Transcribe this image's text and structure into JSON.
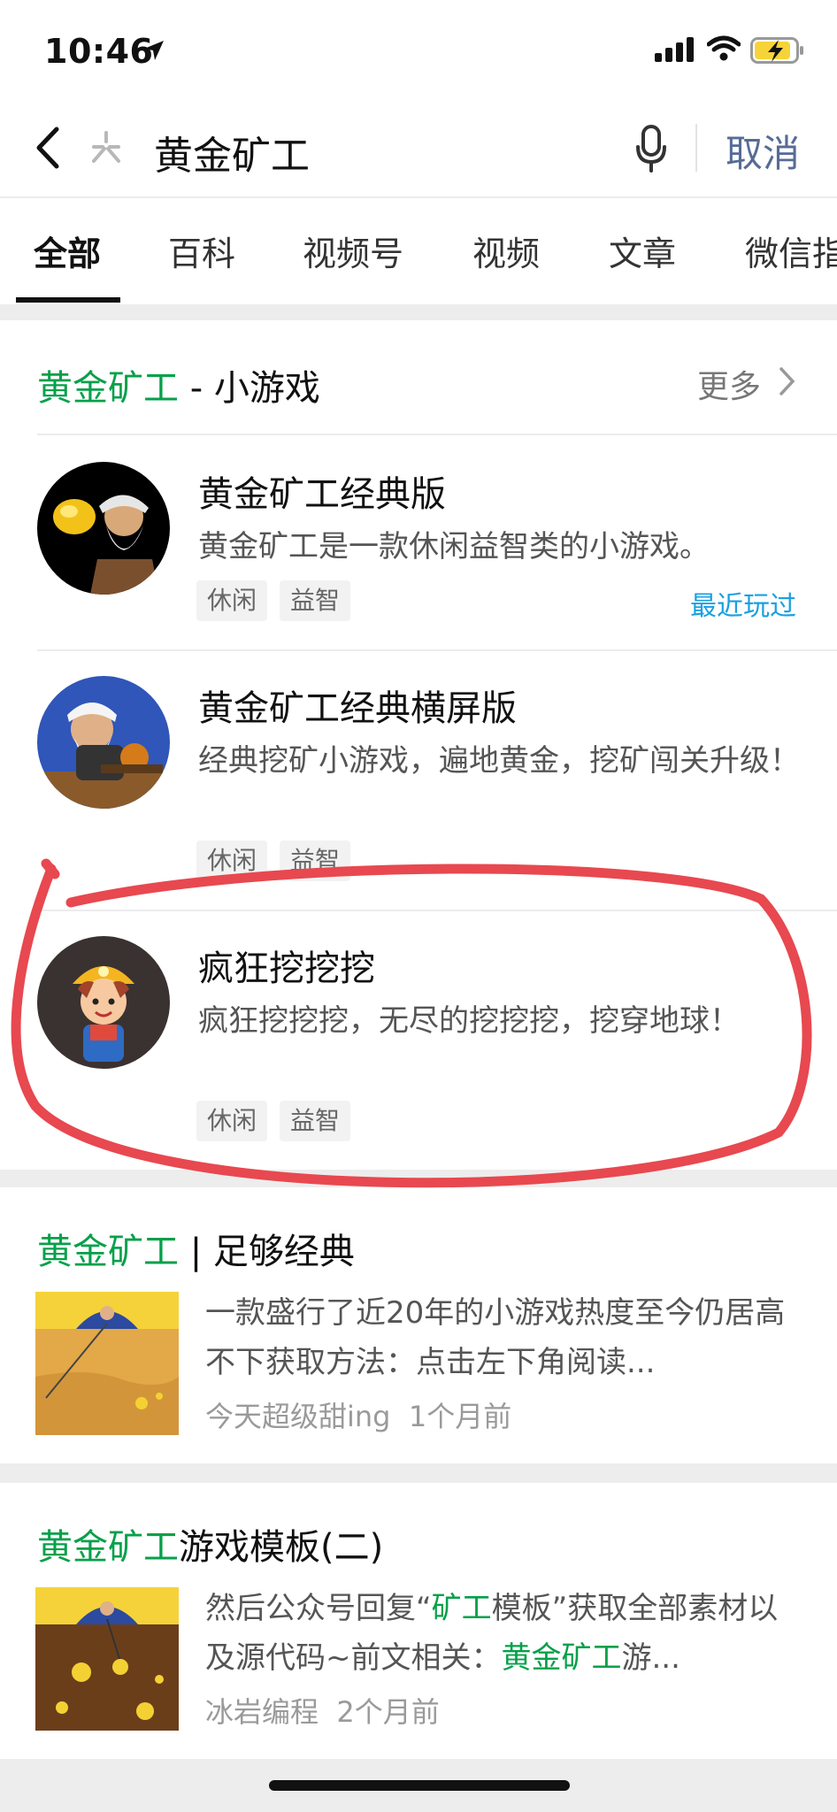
{
  "status": {
    "time": "10:46"
  },
  "search": {
    "query": "黄金矿工",
    "cancel": "取消"
  },
  "tabs": [
    "全部",
    "百科",
    "视频号",
    "视频",
    "文章",
    "微信指"
  ],
  "minigames": {
    "title_highlight": "黄金矿工",
    "title_rest": " - 小游戏",
    "more": "更多",
    "items": [
      {
        "name": "黄金矿工经典版",
        "desc": "黄金矿工是一款休闲益智类的小游戏。",
        "tags": [
          "休闲",
          "益智"
        ],
        "recent": "最近玩过",
        "icon": "gold-miner-classic-icon"
      },
      {
        "name": "黄金矿工经典横屏版",
        "desc": "经典挖矿小游戏，遍地黄金，挖矿闯关升级！",
        "tags": [
          "休闲",
          "益智"
        ],
        "icon": "gold-miner-landscape-icon"
      },
      {
        "name": "疯狂挖挖挖",
        "desc": "疯狂挖挖挖，无尽的挖挖挖，挖穿地球！",
        "tags": [
          "休闲",
          "益智"
        ],
        "icon": "crazy-dig-icon"
      }
    ]
  },
  "articles": [
    {
      "title_highlight": "黄金矿工",
      "title_rest": " | 足够经典",
      "desc": "一款盛行了近20年的小游戏热度至今仍居高不下获取方法：点击左下角阅读...",
      "source": "今天超级甜ing",
      "time": "1个月前"
    },
    {
      "title_highlight": "黄金矿工",
      "title_rest": "游戏模板(二)",
      "desc_parts": [
        "然后公众号回复“",
        "矿工",
        "模板”获取全部素材以及源代码~前文相关：",
        "黄金矿工",
        "游..."
      ],
      "source": "冰岩编程",
      "time": "2个月前"
    }
  ],
  "colors": {
    "highlight": "#07a04a",
    "link": "#576b95",
    "recent": "#19a0e0",
    "annotation": "#e8484f"
  }
}
